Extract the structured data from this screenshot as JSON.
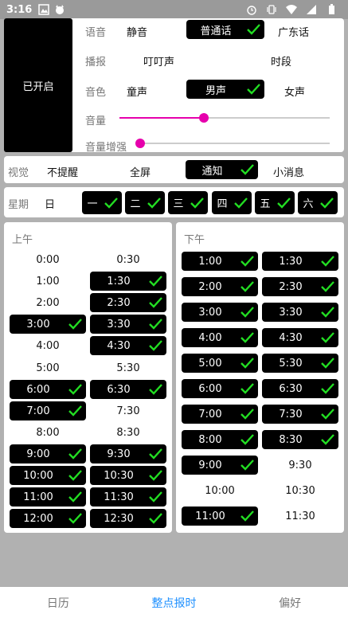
{
  "status": {
    "time": "3:16"
  },
  "enable_toggle": "已开启",
  "voice": {
    "label": "语音",
    "options": [
      "静音",
      "普通话",
      "广东话"
    ]
  },
  "announce": {
    "label": "播报",
    "options": [
      "叮叮声",
      "时段"
    ]
  },
  "timbre": {
    "label": "音色",
    "options": [
      "童声",
      "男声",
      "女声"
    ]
  },
  "volume": {
    "label": "音量",
    "value": 0.4
  },
  "boost": {
    "label": "音量增强",
    "value": 0.0
  },
  "visual": {
    "label": "视觉",
    "options": [
      "不提醒",
      "全屏",
      "通知",
      "小消息"
    ]
  },
  "week": {
    "label": "星期",
    "days": [
      "日",
      "一",
      "二",
      "三",
      "四",
      "五",
      "六"
    ]
  },
  "am": {
    "title": "上午",
    "left": [
      {
        "t": "0:00",
        "on": false
      },
      {
        "t": "1:00",
        "on": false
      },
      {
        "t": "2:00",
        "on": false
      },
      {
        "t": "3:00",
        "on": true
      },
      {
        "t": "4:00",
        "on": false
      },
      {
        "t": "5:00",
        "on": false
      },
      {
        "t": "6:00",
        "on": true
      },
      {
        "t": "7:00",
        "on": true
      },
      {
        "t": "8:00",
        "on": false
      },
      {
        "t": "9:00",
        "on": true
      },
      {
        "t": "10:00",
        "on": true
      },
      {
        "t": "11:00",
        "on": true
      },
      {
        "t": "12:00",
        "on": true
      }
    ],
    "right": [
      {
        "t": "0:30",
        "on": false
      },
      {
        "t": "1:30",
        "on": true
      },
      {
        "t": "2:30",
        "on": true
      },
      {
        "t": "3:30",
        "on": true
      },
      {
        "t": "4:30",
        "on": true
      },
      {
        "t": "5:30",
        "on": false
      },
      {
        "t": "6:30",
        "on": true
      },
      {
        "t": "7:30",
        "on": false
      },
      {
        "t": "8:30",
        "on": false
      },
      {
        "t": "9:30",
        "on": true
      },
      {
        "t": "10:30",
        "on": true
      },
      {
        "t": "11:30",
        "on": true
      },
      {
        "t": "12:30",
        "on": true
      }
    ]
  },
  "pm": {
    "title": "下午",
    "left": [
      {
        "t": "1:00",
        "on": true
      },
      {
        "t": "2:00",
        "on": true
      },
      {
        "t": "3:00",
        "on": true
      },
      {
        "t": "4:00",
        "on": true
      },
      {
        "t": "5:00",
        "on": true
      },
      {
        "t": "6:00",
        "on": true
      },
      {
        "t": "7:00",
        "on": true
      },
      {
        "t": "8:00",
        "on": true
      },
      {
        "t": "9:00",
        "on": true
      },
      {
        "t": "10:00",
        "on": false
      },
      {
        "t": "11:00",
        "on": true
      }
    ],
    "right": [
      {
        "t": "1:30",
        "on": true
      },
      {
        "t": "2:30",
        "on": true
      },
      {
        "t": "3:30",
        "on": true
      },
      {
        "t": "4:30",
        "on": true
      },
      {
        "t": "5:30",
        "on": true
      },
      {
        "t": "6:30",
        "on": true
      },
      {
        "t": "7:30",
        "on": true
      },
      {
        "t": "8:30",
        "on": true
      },
      {
        "t": "9:30",
        "on": false
      },
      {
        "t": "10:30",
        "on": false
      },
      {
        "t": "11:30",
        "on": false
      }
    ]
  },
  "tabs": [
    "日历",
    "整点报时",
    "偏好"
  ],
  "colors": {
    "accent": "#e600ac",
    "check": "#22dd22",
    "active_tab": "#1e90ff"
  }
}
